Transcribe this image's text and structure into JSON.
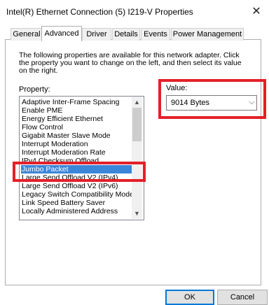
{
  "window": {
    "title": "Intel(R) Ethernet Connection (5) I219-V Properties",
    "close_glyph": "✕"
  },
  "tabs": [
    {
      "label": "General",
      "active": false
    },
    {
      "label": "Advanced",
      "active": true
    },
    {
      "label": "Driver",
      "active": false
    },
    {
      "label": "Details",
      "active": false
    },
    {
      "label": "Events",
      "active": false
    },
    {
      "label": "Power Management",
      "active": false
    }
  ],
  "description": {
    "line1": "The following properties are available for this network adapter. Click",
    "line2": "the property you want to change on the left, and then select its value",
    "line3": "on the right."
  },
  "property": {
    "label": "Property:",
    "items": [
      "Adaptive Inter-Frame Spacing",
      "Enable PME",
      "Energy Efficient Ethernet",
      "Flow Control",
      "Gigabit Master Slave Mode",
      "Interrupt Moderation",
      "Interrupt Moderation Rate",
      "IPv4 Checksum Offload",
      "Jumbo Packet",
      "Large Send Offload V2 (IPv4)",
      "Large Send Offload V2 (IPv6)",
      "Legacy Switch Compatibility Mode",
      "Link Speed Battery Saver",
      "Locally Administered Address"
    ],
    "selected": "Jumbo Packet"
  },
  "value": {
    "label": "Value:",
    "selected": "9014 Bytes"
  },
  "buttons": {
    "ok": "OK",
    "cancel": "Cancel"
  },
  "colors": {
    "highlight_box": "#e32029",
    "selection": "#3b86d9",
    "ok_border": "#0078d7"
  },
  "icons": [
    "close-icon",
    "scroll-up-icon",
    "scroll-down-icon",
    "chevron-down-icon"
  ]
}
